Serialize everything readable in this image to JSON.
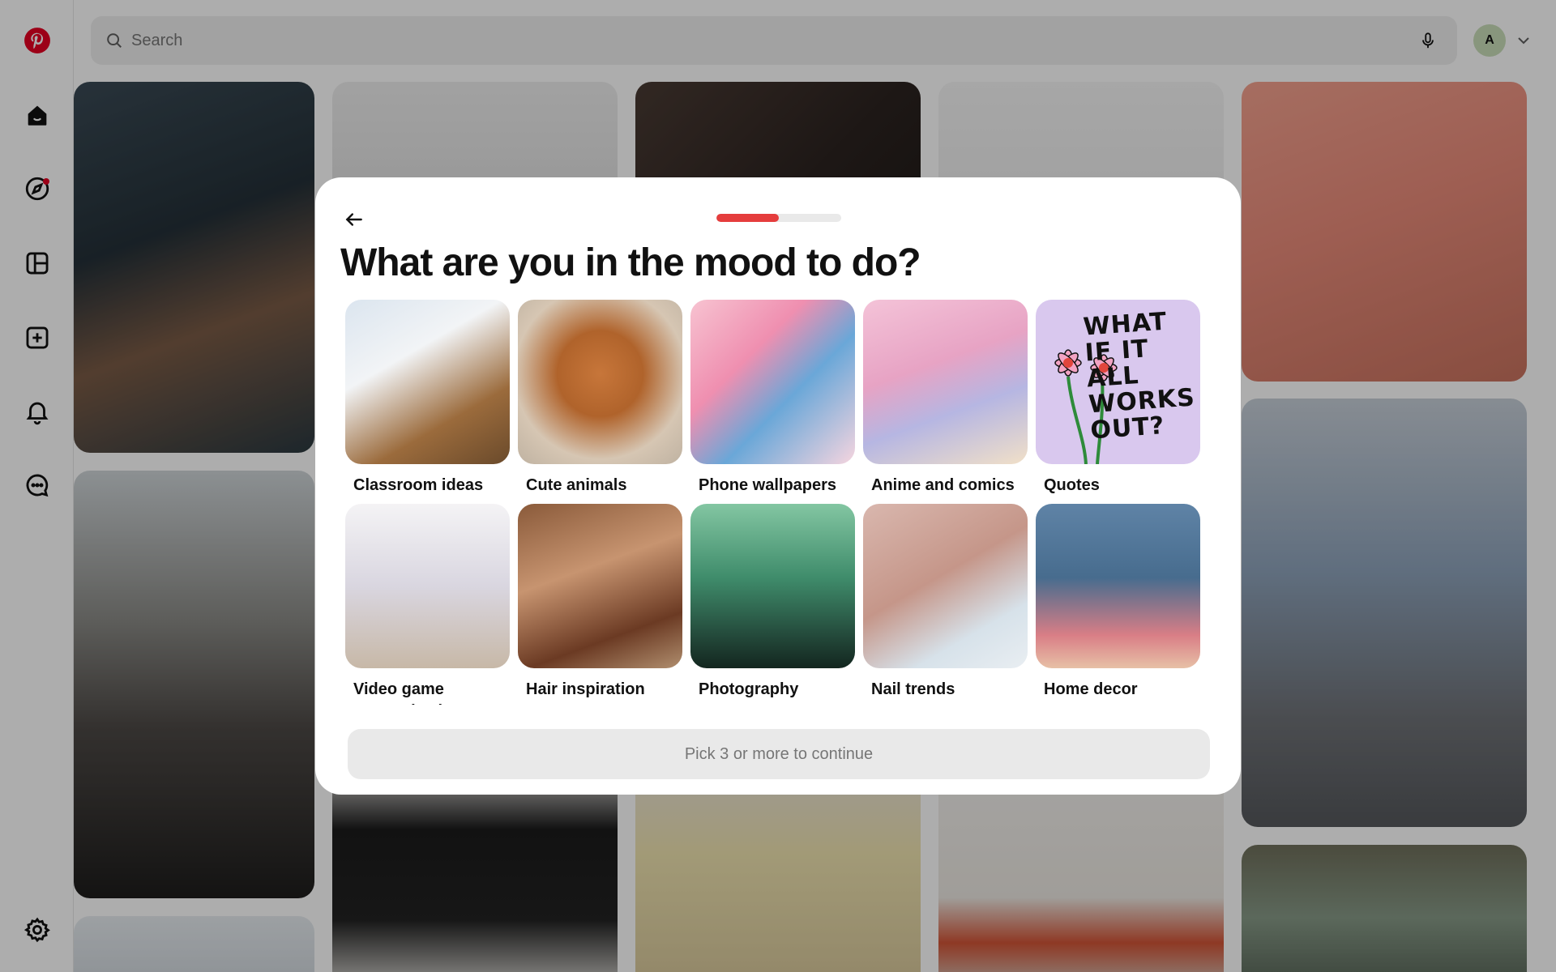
{
  "app": {
    "brand_color": "#e60023",
    "logo_icon": "pinterest-logo-icon"
  },
  "rail": {
    "items": [
      {
        "name": "home",
        "icon": "home-icon"
      },
      {
        "name": "explore",
        "icon": "compass-icon",
        "has_notification_dot": true
      },
      {
        "name": "boards",
        "icon": "boards-icon"
      },
      {
        "name": "create",
        "icon": "plus-square-icon"
      },
      {
        "name": "notifications",
        "icon": "bell-icon"
      },
      {
        "name": "messages",
        "icon": "chat-icon"
      }
    ],
    "settings_icon": "gear-icon"
  },
  "header": {
    "search_placeholder": "Search",
    "avatar_letter": "A",
    "avatar_color": "#c9ddb8"
  },
  "modal": {
    "title": "What are you in the mood to do?",
    "progress_fraction": 0.5,
    "progress_color": "#e53d3d",
    "continue_label": "Pick 3 or more to continue",
    "topics": [
      {
        "label": "Classroom ideas",
        "thumb": "th-class"
      },
      {
        "label": "Cute animals",
        "thumb": "th-dog"
      },
      {
        "label": "Phone wallpapers",
        "thumb": "th-wall"
      },
      {
        "label": "Anime and comics",
        "thumb": "th-anime"
      },
      {
        "label": "Quotes",
        "thumb": "th-quote",
        "thumb_text": "WHAT IF IT ALL WORKS OUT?"
      },
      {
        "label": "Video game customization",
        "thumb": "th-game"
      },
      {
        "label": "Hair inspiration",
        "thumb": "th-hair"
      },
      {
        "label": "Photography",
        "thumb": "th-photo"
      },
      {
        "label": "Nail trends",
        "thumb": "th-nails"
      },
      {
        "label": "Home decor",
        "thumb": "th-home"
      }
    ]
  }
}
